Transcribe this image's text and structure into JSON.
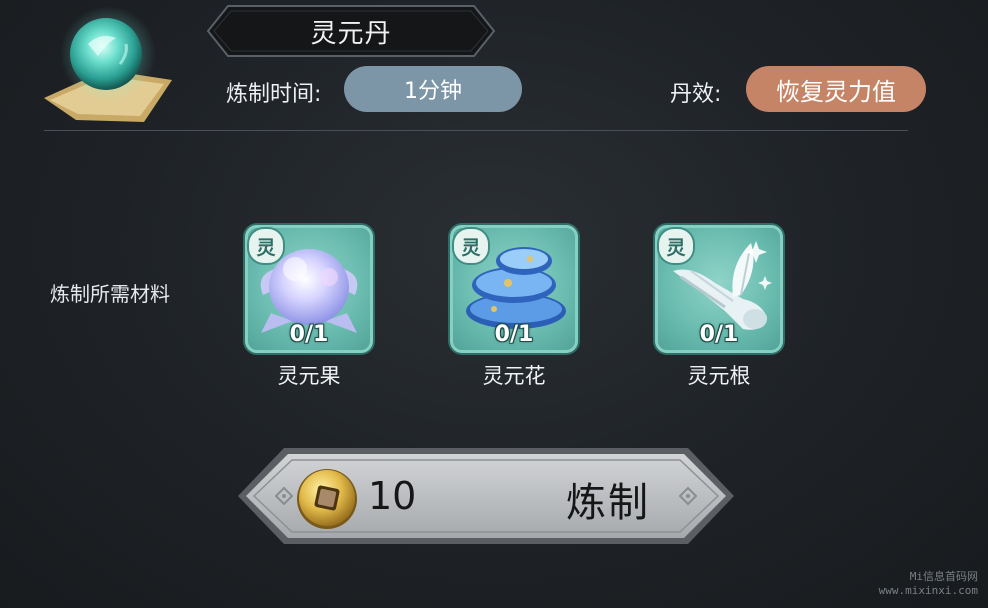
{
  "pill": {
    "name": "灵元丹",
    "craft_time_label": "炼制时间:",
    "craft_time_value": "1分钟",
    "effect_label": "丹效:",
    "effect_value": "恢复灵力值",
    "icon": "glowing-orb-icon"
  },
  "materials": {
    "section_label": "炼制所需材料",
    "badge_text": "灵",
    "items": [
      {
        "name": "灵元果",
        "count": "0/1",
        "icon": "spirit-fruit-icon"
      },
      {
        "name": "灵元花",
        "count": "0/1",
        "icon": "spirit-flower-icon"
      },
      {
        "name": "灵元根",
        "count": "0/1",
        "icon": "spirit-root-icon"
      }
    ]
  },
  "craft_button": {
    "cost": "10",
    "label": "炼制",
    "currency_icon": "copper-coin-icon"
  },
  "watermark": {
    "line1": "Mi信息首码网",
    "line2": "www.mixinxi.com"
  },
  "colors": {
    "background": "#1c1f22",
    "time_pill": "#7c96a8",
    "effect_pill": "#c58466",
    "material_card": "#6bbcb0",
    "button_plate": "#b9bcbe"
  }
}
